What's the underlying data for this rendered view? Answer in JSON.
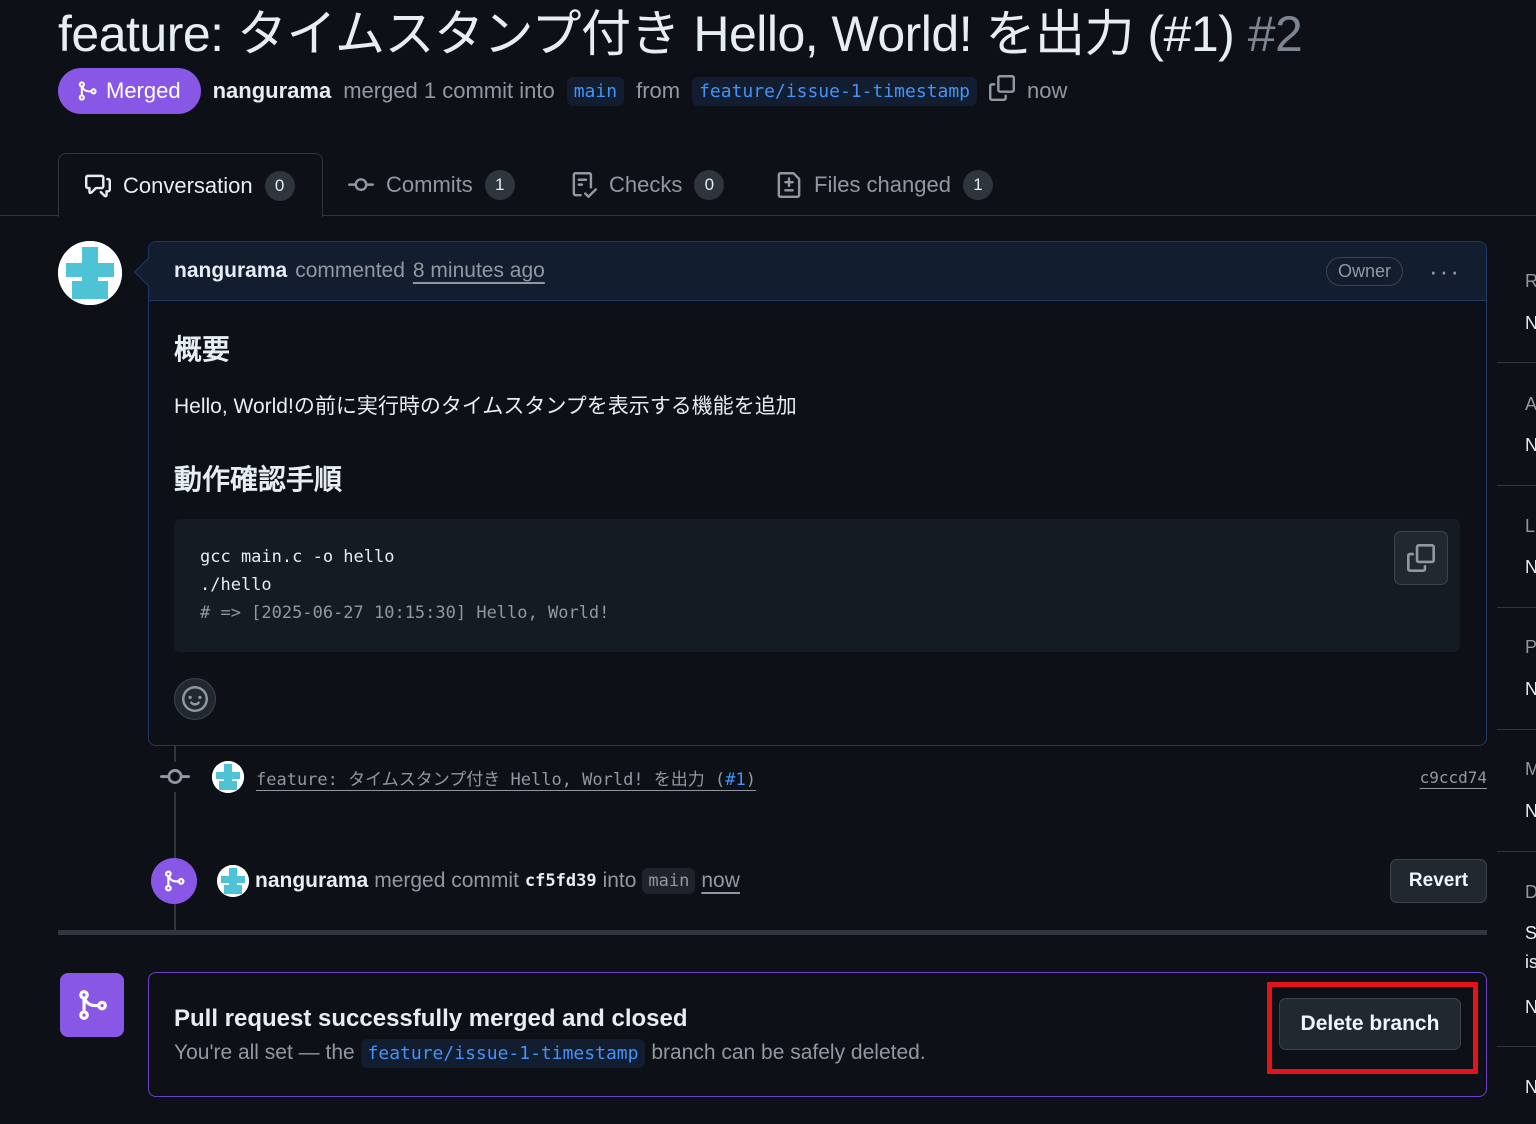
{
  "pr": {
    "title": "feature: タイムスタンプ付き Hello, World! を出力 (#1) ",
    "number": "#2",
    "state": "Merged",
    "author": "nangurama",
    "merge_text": "merged 1 commit into",
    "base_branch": "main",
    "from_text": "from",
    "head_branch": "feature/issue-1-timestamp",
    "time": "now"
  },
  "tabs": [
    {
      "label": "Conversation",
      "count": "0"
    },
    {
      "label": "Commits",
      "count": "1"
    },
    {
      "label": "Checks",
      "count": "0"
    },
    {
      "label": "Files changed",
      "count": "1"
    }
  ],
  "comment": {
    "author": "nangurama",
    "action": "commented",
    "timestamp": "8 minutes ago",
    "badge": "Owner",
    "menu": "···",
    "heading1": "概要",
    "paragraph": "Hello, World!の前に実行時のタイムスタンプを表示する機能を追加",
    "heading2": "動作確認手順",
    "code_lines": [
      "gcc main.c -o hello",
      "./hello",
      "# => [2025-06-27 10:15:30] Hello, World!"
    ]
  },
  "commit_event": {
    "message": "feature: タイムスタンプ付き Hello, World! を出力 (",
    "issue": "#1",
    "close": ")",
    "sha": "c9ccd74"
  },
  "merge_event": {
    "author": "nangurama",
    "text": "merged commit",
    "sha": "cf5fd39",
    "into": "into",
    "branch": "main",
    "time": "now",
    "revert_label": "Revert"
  },
  "merged_banner": {
    "title": "Pull request successfully merged and closed",
    "sub_before": "You're all set — the",
    "branch": "feature/issue-1-timestamp",
    "sub_after": "branch can be safely deleted.",
    "delete_label": "Delete branch"
  },
  "sidebar": [
    "R",
    "N",
    "A",
    "N",
    "L",
    "N",
    "P",
    "N",
    "M",
    "N",
    "D",
    "S",
    "is",
    "N",
    "N"
  ],
  "colors": {
    "accent": "#8957e5",
    "link": "#4493f8",
    "highlight": "#e3131b",
    "bg": "#0d1117"
  }
}
